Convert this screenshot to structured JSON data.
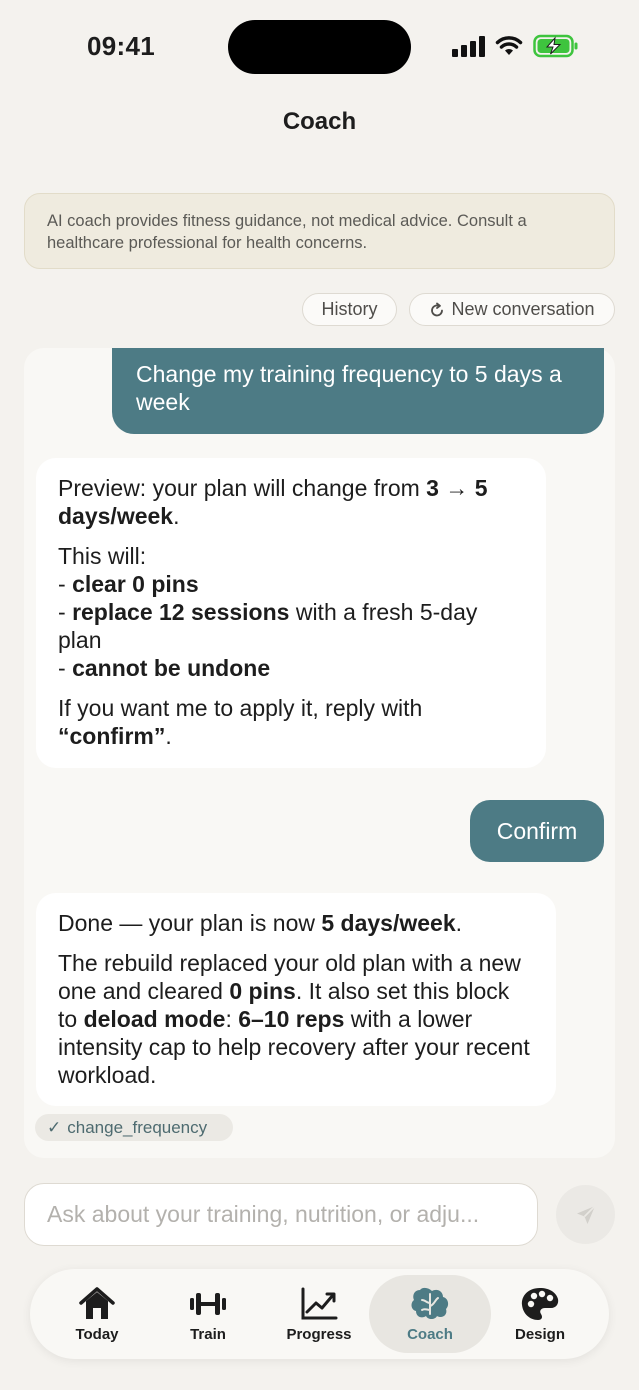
{
  "status": {
    "time": "09:41"
  },
  "header": {
    "title": "Coach"
  },
  "disclaimer": "AI coach provides fitness guidance, not medical advice. Consult a healthcare professional for health concerns.",
  "actions": {
    "history": "History",
    "new_conversation": "New conversation"
  },
  "messages": {
    "user_1": "Change my training frequency to 5 days a week",
    "ai_1": {
      "p1_a": "Preview: your plan will change from ",
      "p1_b": "3 → 5 days/week",
      "p1_c": ".",
      "p2_intro": "This will:",
      "bullet1_a": "- ",
      "bullet1_b": "clear 0 pins",
      "bullet2_a": "- ",
      "bullet2_b": "replace 12 sessions",
      "bullet2_c": " with a fresh 5-day plan",
      "bullet3_a": "- ",
      "bullet3_b": "cannot be undone",
      "p3_a": "If you want me to apply it, reply with ",
      "p3_b": "“confirm”",
      "p3_c": "."
    },
    "user_2": "Confirm",
    "ai_2": {
      "p1_a": "Done — your plan is now ",
      "p1_b": "5 days/week",
      "p1_c": ".",
      "p2_a": "The rebuild replaced your old plan with a new one and cleared ",
      "p2_b": "0 pins",
      "p2_c": ". It also set this block to ",
      "p2_d": "deload mode",
      "p2_e": ": ",
      "p2_f": "6–10 reps",
      "p2_g": " with a lower intensity cap to help recovery after your recent workload."
    },
    "tool_call": {
      "check": "✓",
      "name": "change_frequency"
    }
  },
  "input": {
    "placeholder": "Ask about your training, nutrition, or adju..."
  },
  "tabs": [
    {
      "label": "Today",
      "icon": "house-icon"
    },
    {
      "label": "Train",
      "icon": "dumbbell-icon"
    },
    {
      "label": "Progress",
      "icon": "chart-icon"
    },
    {
      "label": "Coach",
      "icon": "brain-icon"
    },
    {
      "label": "Design",
      "icon": "palette-icon"
    }
  ],
  "colors": {
    "accent": "#4d7b85",
    "background": "#f4f2ee",
    "disclaimer_bg": "#efebdf",
    "battery_green": "#3ec43e"
  }
}
